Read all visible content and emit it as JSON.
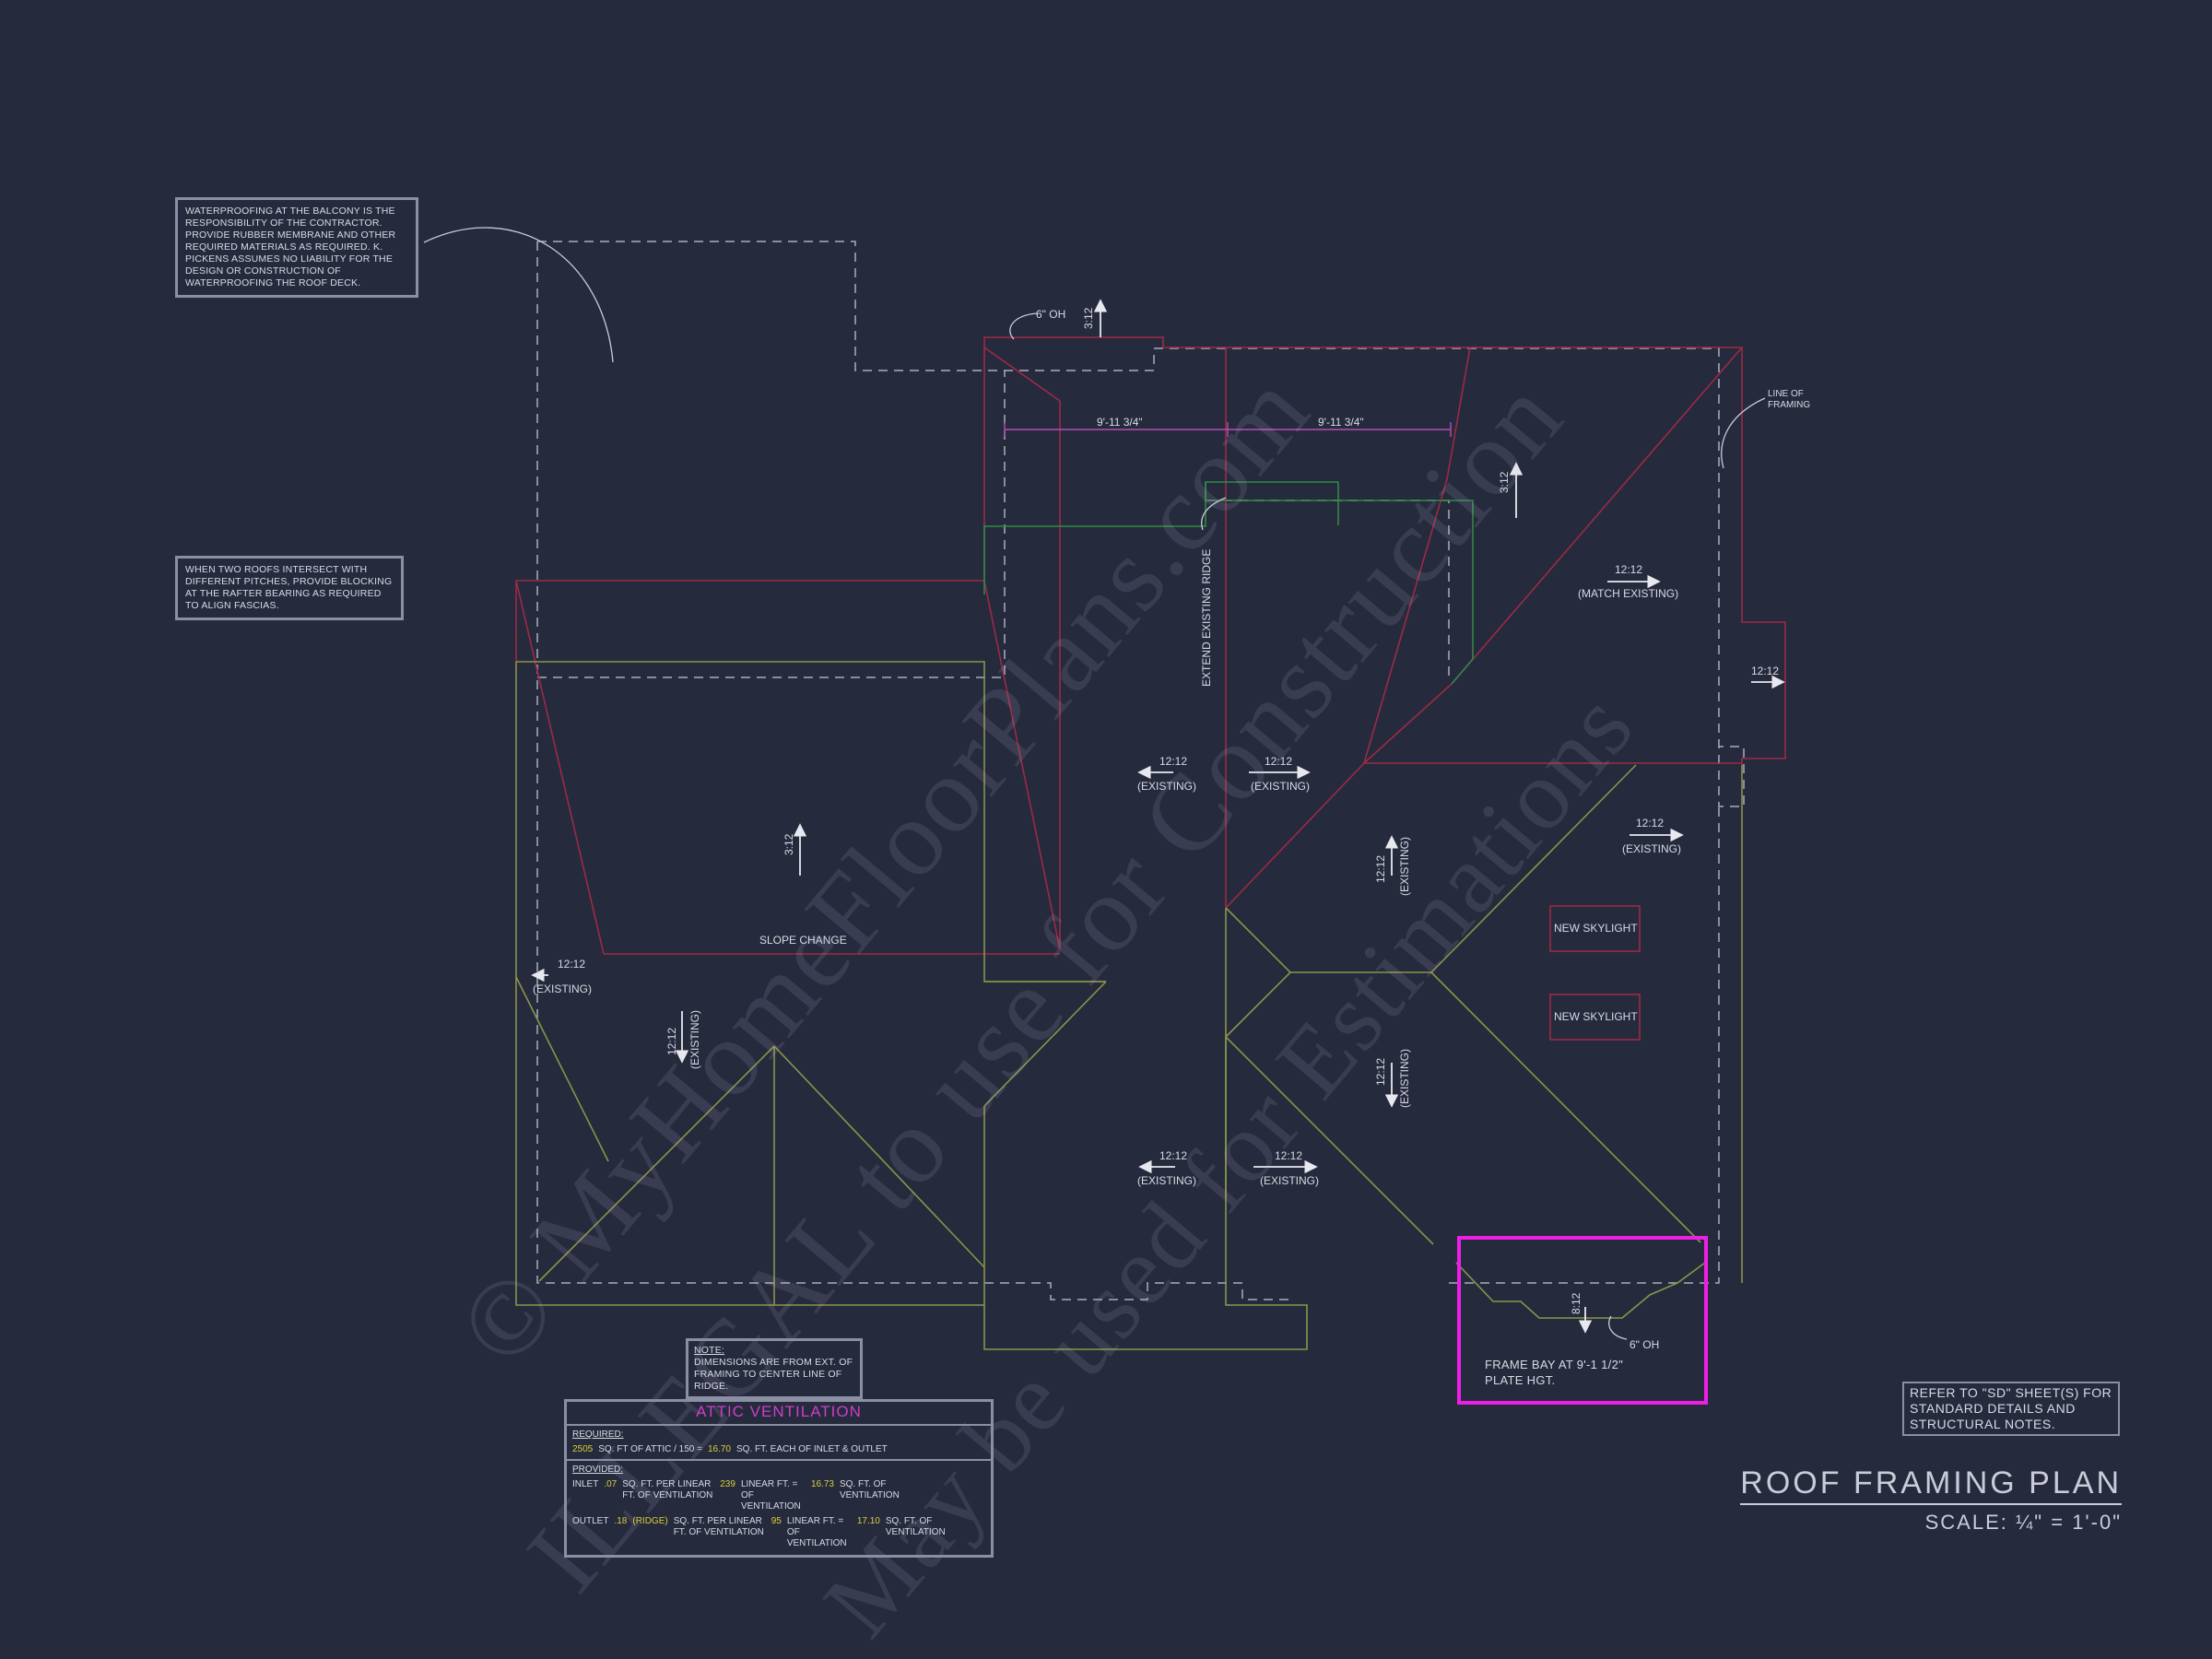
{
  "notes": {
    "waterproofing": "WATERPROOFING AT THE BALCONY IS THE RESPONSIBILITY OF THE CONTRACTOR. PROVIDE RUBBER MEMBRANE AND OTHER REQUIRED MATERIALS AS REQUIRED. K. PICKENS ASSUMES NO LIABILITY FOR THE DESIGN OR CONSTRUCTION OF WATERPROOFING THE ROOF DECK.",
    "intersect": "WHEN TWO ROOFS INTERSECT WITH DIFFERENT PITCHES, PROVIDE BLOCKING AT THE RAFTER BEARING AS REQUIRED TO ALIGN FASCIAS.",
    "dimensions_label": "NOTE:",
    "dimensions": "DIMENSIONS ARE FROM EXT. OF FRAMING TO CENTER LINE OF RIDGE.",
    "refer": "REFER TO \"SD\" SHEET(S) FOR STANDARD DETAILS AND STRUCTURAL NOTES."
  },
  "labels": {
    "oh_top": "6\" OH",
    "pitch_312": "3:12",
    "dim_left": "9'-11 3/4\"",
    "dim_right": "9'-11 3/4\"",
    "line_of_framing": "LINE OF FRAMING",
    "extend_ridge": "EXTEND EXISTING RIDGE",
    "pitch_1212": "12:12",
    "existing": "(EXISTING)",
    "match_existing": "(MATCH EXISTING)",
    "slope_change": "SLOPE CHANGE",
    "new_skylight": "NEW SKYLIGHT",
    "pitch_812": "8:12",
    "oh_bottom": "6\" OH",
    "frame_bay": "FRAME BAY AT 9'-1 1/2\" PLATE HGT."
  },
  "attic": {
    "title": "ATTIC VENTILATION",
    "required_label": "REQUIRED:",
    "required_sqft": "2505",
    "required_text1": "SQ. FT OF ATTIC / 150 =",
    "required_result": "16.70",
    "required_text2": "SQ. FT. EACH OF INLET & OUTLET",
    "provided_label": "PROVIDED:",
    "inlet_label": "INLET",
    "inlet_rate": ".07",
    "inlet_text1": "SQ. FT. PER LINEAR FT. OF VENTILATION",
    "inlet_len": "239",
    "inlet_text2": "LINEAR FT. = OF VENTILATION",
    "inlet_total": "16.73",
    "inlet_text3": "SQ. FT. OF VENTILATION",
    "outlet_label": "OUTLET",
    "outlet_rate": ".18",
    "outlet_type": "(RIDGE)",
    "outlet_text1": "SQ. FT. PER LINEAR FT. OF VENTILATION",
    "outlet_len": "95",
    "outlet_text2": "LINEAR FT. = OF VENTILATION",
    "outlet_total": "17.10",
    "outlet_text3": "SQ. FT. OF VENTILATION"
  },
  "title": {
    "name": "ROOF FRAMING PLAN",
    "scale": "SCALE: ¼\" = 1'-0\""
  },
  "watermark": {
    "line1": "© MyHomeFloorPlans.com",
    "line2": "ILLEGAL to use for Construction",
    "line3": "May be used for Estimations"
  },
  "colors": {
    "background": "#262a3d",
    "existing_roof": "#9c2a45",
    "hip_lines": "#8a9448",
    "ridge_green": "#2f8a44",
    "dashed_wall": "#a9acbb",
    "highlight": "#ee1ee8"
  }
}
